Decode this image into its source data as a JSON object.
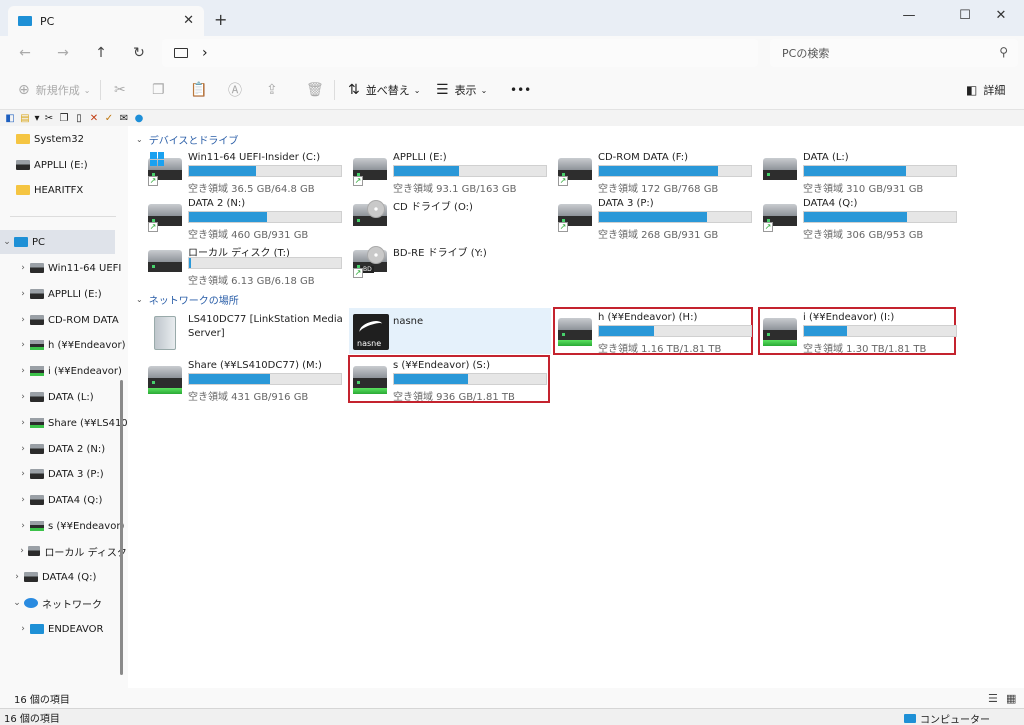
{
  "window": {
    "tab_title": "PC",
    "close_tab": "✕",
    "new_tab": "+",
    "minimize": "—",
    "maximize": "☐",
    "close": "✕"
  },
  "address": {
    "back": "←",
    "forward": "→",
    "up": "↑",
    "refresh": "↻",
    "chevron": "›",
    "search_placeholder": "PCの検索"
  },
  "commands": {
    "new": "新規作成",
    "sort": "並べ替え",
    "view": "表示",
    "more": "•••",
    "details": "詳細"
  },
  "nav": {
    "items": [
      {
        "label": "System32",
        "icon": "folder"
      },
      {
        "label": "APPLLI (E:)",
        "icon": "drive"
      },
      {
        "label": "HEARITFX",
        "icon": "folder"
      },
      {
        "label": "PC",
        "icon": "pc"
      },
      {
        "label": "Win11-64 UEFI",
        "icon": "drive"
      },
      {
        "label": "APPLLI (E:)",
        "icon": "drive"
      },
      {
        "label": "CD-ROM DATA",
        "icon": "drive"
      },
      {
        "label": "h (¥¥Endeavor)",
        "icon": "net-drive"
      },
      {
        "label": "i (¥¥Endeavor)",
        "icon": "net-drive"
      },
      {
        "label": "DATA (L:)",
        "icon": "drive"
      },
      {
        "label": "Share (¥¥LS410",
        "icon": "net-drive"
      },
      {
        "label": "DATA 2 (N:)",
        "icon": "drive"
      },
      {
        "label": "DATA 3 (P:)",
        "icon": "drive"
      },
      {
        "label": "DATA4 (Q:)",
        "icon": "drive"
      },
      {
        "label": "s (¥¥Endeavor)",
        "icon": "net-drive"
      },
      {
        "label": "ローカル ディスク (",
        "icon": "drive"
      },
      {
        "label": "DATA4 (Q:)",
        "icon": "drive"
      },
      {
        "label": "ネットワーク",
        "icon": "network"
      },
      {
        "label": "ENDEAVOR",
        "icon": "pc"
      }
    ]
  },
  "groups": {
    "devices": "デバイスとドライブ",
    "network": "ネットワークの場所"
  },
  "drives": [
    {
      "name": "Win11-64 UEFI-Insider (C:)",
      "space": "空き領域 36.5 GB/64.8 GB",
      "used": 0.44
    },
    {
      "name": "APPLLI (E:)",
      "space": "空き領域 93.1 GB/163 GB",
      "used": 0.43
    },
    {
      "name": "CD-ROM DATA (F:)",
      "space": "空き領域 172 GB/768 GB",
      "used": 0.78
    },
    {
      "name": "DATA (L:)",
      "space": "空き領域 310 GB/931 GB",
      "used": 0.67
    },
    {
      "name": "DATA 2 (N:)",
      "space": "空き領域 460 GB/931 GB",
      "used": 0.51
    },
    {
      "name": "CD ドライブ (O:)",
      "space": ""
    },
    {
      "name": "DATA 3 (P:)",
      "space": "空き領域 268 GB/931 GB",
      "used": 0.71
    },
    {
      "name": "DATA4 (Q:)",
      "space": "空き領域 306 GB/953 GB",
      "used": 0.68
    },
    {
      "name": "ローカル ディスク (T:)",
      "space": "空き領域 6.13 GB/6.18 GB",
      "used": 0.01
    },
    {
      "name": "BD-RE ドライブ (Y:)",
      "space": ""
    }
  ],
  "network_locations": [
    {
      "name": "LS410DC77 [LinkStation Media",
      "name2": "Server]"
    },
    {
      "name": "nasne",
      "logo_text": "nasne"
    },
    {
      "name": "h (¥¥Endeavor) (H:)",
      "space": "空き領域 1.16 TB/1.81 TB",
      "used": 0.36
    },
    {
      "name": "i (¥¥Endeavor) (I:)",
      "space": "空き領域 1.30 TB/1.81 TB",
      "used": 0.28
    },
    {
      "name": "Share (¥¥LS410DC77) (M:)",
      "space": "空き領域 431 GB/916 GB",
      "used": 0.53
    },
    {
      "name": "s (¥¥Endeavor) (S:)",
      "space": "空き領域 936 GB/1.81 TB",
      "used": 0.49
    }
  ],
  "icons": {
    "bd_label": "BD",
    "shortcut": "↗"
  },
  "status": {
    "items_count": "16 個の項目",
    "items_count_bottom": "16 個の項目",
    "computer": "コンピューター"
  }
}
